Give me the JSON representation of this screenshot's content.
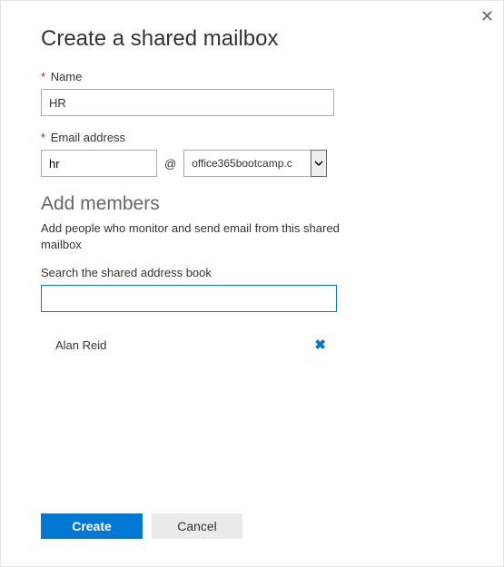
{
  "title": "Create a shared mailbox",
  "required_marker": "*",
  "name_field": {
    "label": "Name",
    "value": "HR"
  },
  "email_field": {
    "label": "Email address",
    "local": "hr",
    "at": "@",
    "domain": "office365bootcamp.c"
  },
  "members": {
    "heading": "Add members",
    "helper": "Add people who monitor and send email from this shared mailbox",
    "search_label": "Search the shared address book",
    "search_value": "",
    "list": [
      {
        "name": "Alan Reid"
      }
    ]
  },
  "buttons": {
    "create": "Create",
    "cancel": "Cancel"
  }
}
